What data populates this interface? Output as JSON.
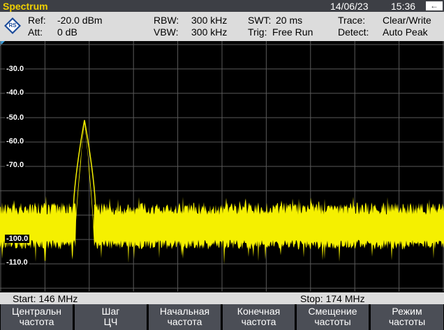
{
  "header": {
    "mode": "Spectrum",
    "date": "14/06/23",
    "time": "15:36",
    "back_icon": "back-arrow-icon"
  },
  "settings": {
    "ref_label": "Ref:",
    "ref_value": "-20.0 dBm",
    "att_label": "Att:",
    "att_value": "0 dB",
    "rbw_label": "RBW:",
    "rbw_value": "300 kHz",
    "vbw_label": "VBW:",
    "vbw_value": "300 kHz",
    "swt_label": "SWT:",
    "swt_value": "20 ms",
    "trig_label": "Trig:",
    "trig_value": "Free Run",
    "trace_label": "Trace:",
    "trace_value": "Clear/Write",
    "detect_label": "Detect:",
    "detect_value": "Auto Peak"
  },
  "graph": {
    "y_labels": [
      "-30.0",
      "-40.0",
      "-50.0",
      "-60.0",
      "-70.0",
      "-100.0",
      "-110.0"
    ],
    "trace_color": "#f5f000",
    "grid_color": "#5a5a5a"
  },
  "span": {
    "start": "Start:  146 MHz",
    "stop": "Stop: 174 MHz"
  },
  "softkeys": [
    {
      "line1": "Центральн",
      "line2": "частота"
    },
    {
      "line1": "Шаг",
      "line2": "ЦЧ"
    },
    {
      "line1": "Начальная",
      "line2": "частота"
    },
    {
      "line1": "Конечная",
      "line2": "частота"
    },
    {
      "line1": "Смещение",
      "line2": "частоты"
    },
    {
      "line1": "Режим",
      "line2": "частоты"
    }
  ],
  "chart_data": {
    "type": "line",
    "x_unit": "MHz",
    "y_unit": "dBm",
    "xlim": [
      146,
      174
    ],
    "ylim": [
      -120,
      -20
    ],
    "noise_floor_dbm": -95,
    "peak": {
      "freq_mhz": 151.3,
      "level_dbm": -51
    }
  }
}
